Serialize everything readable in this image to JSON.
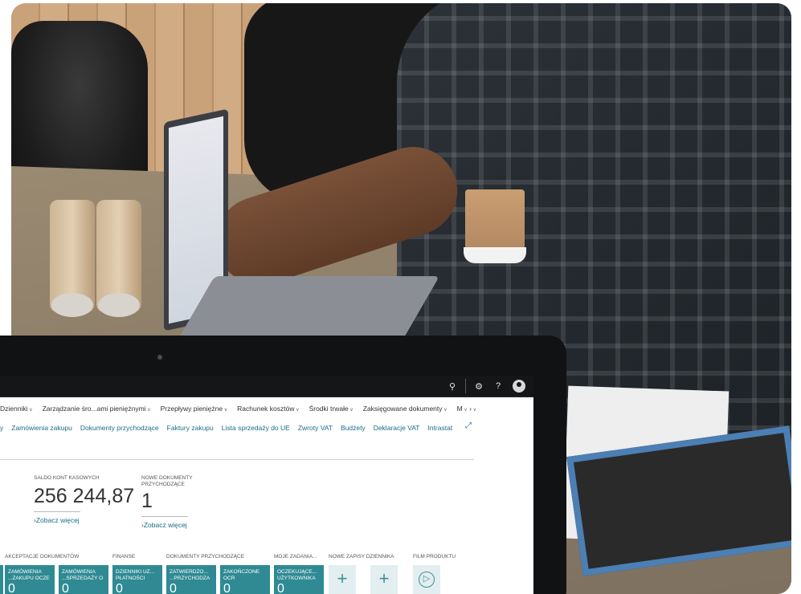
{
  "topbar": {
    "icons": [
      "lightbulb-icon",
      "gear-icon",
      "help-icon",
      "user-avatar-icon"
    ],
    "help_label": "?"
  },
  "menu": {
    "primary": [
      {
        "label": "Dzienniki"
      },
      {
        "label": "Zarządzanie śro...ami pieniężnymi"
      },
      {
        "label": "Przepływy pieniężne"
      },
      {
        "label": "Rachunek kosztów"
      },
      {
        "label": "Środki trwałe"
      },
      {
        "label": "Zaksięgowane dokumenty"
      },
      {
        "label": "M"
      }
    ],
    "secondary": [
      {
        "label": "y"
      },
      {
        "label": "Zamówienia zakupu"
      },
      {
        "label": "Dokumenty przychodzące"
      },
      {
        "label": "Faktury zakupu"
      },
      {
        "label": "Lista sprzedaży do UE"
      },
      {
        "label": "Zwroty VAT"
      },
      {
        "label": "Budżety"
      },
      {
        "label": "Deklaracje VAT"
      },
      {
        "label": "Intrastat"
      }
    ]
  },
  "kpis": [
    {
      "caption": "SALDO KONT KASOWYCH",
      "value": "256 244,87",
      "link": "Zobacz więcej"
    },
    {
      "caption": "NOWE DOKUMENTY PRZYCHODZĄCE",
      "value": "1",
      "link": "Zobacz więcej"
    }
  ],
  "sections": [
    {
      "label": "AKCEPTACJE DOKUMENTÓW"
    },
    {
      "label": "FINANSE"
    },
    {
      "label": "DOKUMENTY PRZYCHODZĄCE"
    },
    {
      "label": "MOJE ZADANIA..."
    },
    {
      "label": "NOWE ZAPISY DZIENNIKA"
    },
    {
      "label": "FILM PRODUKTU"
    }
  ],
  "tiles": [
    {
      "label": "ZAMÓWIENIA ...ZAKUPU OCZE",
      "count": "0"
    },
    {
      "label": "ZAMÓWIENIA ...SPRZEDAŻY O",
      "count": "0"
    },
    {
      "label": "DZIENNIKI UZ... PŁATNOŚCI",
      "count": "0"
    },
    {
      "label": "ZATWIERDZO... ...PRZYCHODZA",
      "count": "0"
    },
    {
      "label": "ZAKOŃCZONE OCR",
      "count": "0"
    },
    {
      "label": "OCZEKUJĄCE... UŻYTKOWNIKA",
      "count": "0"
    }
  ],
  "actions": [
    {
      "symbol": "+",
      "icon": "plus-icon"
    },
    {
      "symbol": "+",
      "icon": "plus-icon"
    },
    {
      "symbol": "▷",
      "icon": "play-icon"
    }
  ],
  "colors": {
    "accent": "#2f8a93",
    "link": "#1a6d8a",
    "topbar": "#141618"
  }
}
